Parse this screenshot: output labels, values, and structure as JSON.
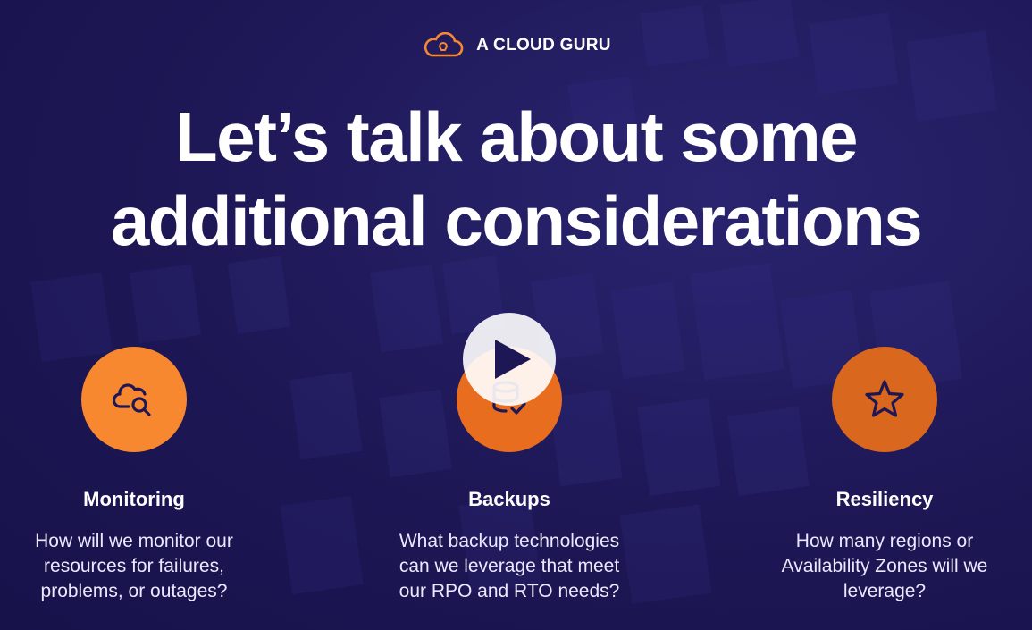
{
  "brand": {
    "name": "A CLOUD GURU",
    "icon": "cloud-icon",
    "accent": "#f7882f"
  },
  "headline": {
    "line1": "Let’s talk about some",
    "line2": "additional considerations"
  },
  "play_button": {
    "icon": "play-icon"
  },
  "items": [
    {
      "title": "Monitoring",
      "icon": "cloud-search-icon",
      "color": "#f7882f",
      "desc_lines": [
        "How will we monitor our",
        "resources for failures,",
        "problems, or outages?"
      ]
    },
    {
      "title": "Backups",
      "icon": "database-check-icon",
      "color": "#e86d1f",
      "desc_lines": [
        "What backup technologies",
        "can we leverage that meet",
        "our RPO and RTO needs?"
      ]
    },
    {
      "title": "Resiliency",
      "icon": "star-icon",
      "color": "#d9671d",
      "desc_lines": [
        "How many regions or",
        "Availability Zones will we",
        "leverage?"
      ]
    }
  ],
  "colors": {
    "background": "#1d1755",
    "icon_stroke": "#1d1755"
  }
}
